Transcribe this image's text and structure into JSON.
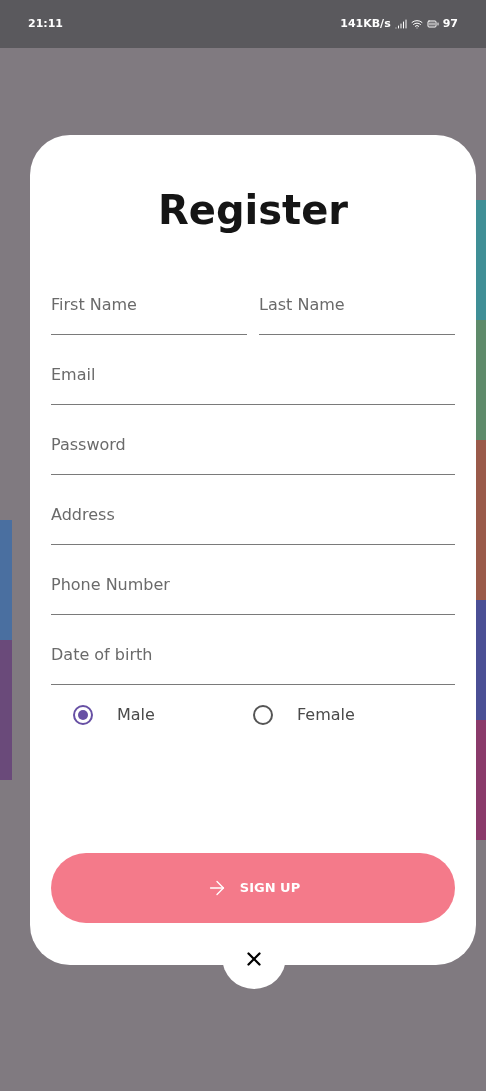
{
  "status_bar": {
    "time": "21:11",
    "network_speed": "141KB/s",
    "battery": "97"
  },
  "title": "Register",
  "name_fields": [
    {
      "placeholder": "First Name"
    },
    {
      "placeholder": "Last Name"
    }
  ],
  "fields": [
    {
      "placeholder": "Email"
    },
    {
      "placeholder": "Password"
    },
    {
      "placeholder": "Address"
    },
    {
      "placeholder": "Phone Number"
    },
    {
      "placeholder": "Date of birth"
    }
  ],
  "gender": [
    {
      "label": "Male",
      "selected": true
    },
    {
      "label": "Female",
      "selected": false
    }
  ],
  "sign_up_button": "SIGN UP"
}
